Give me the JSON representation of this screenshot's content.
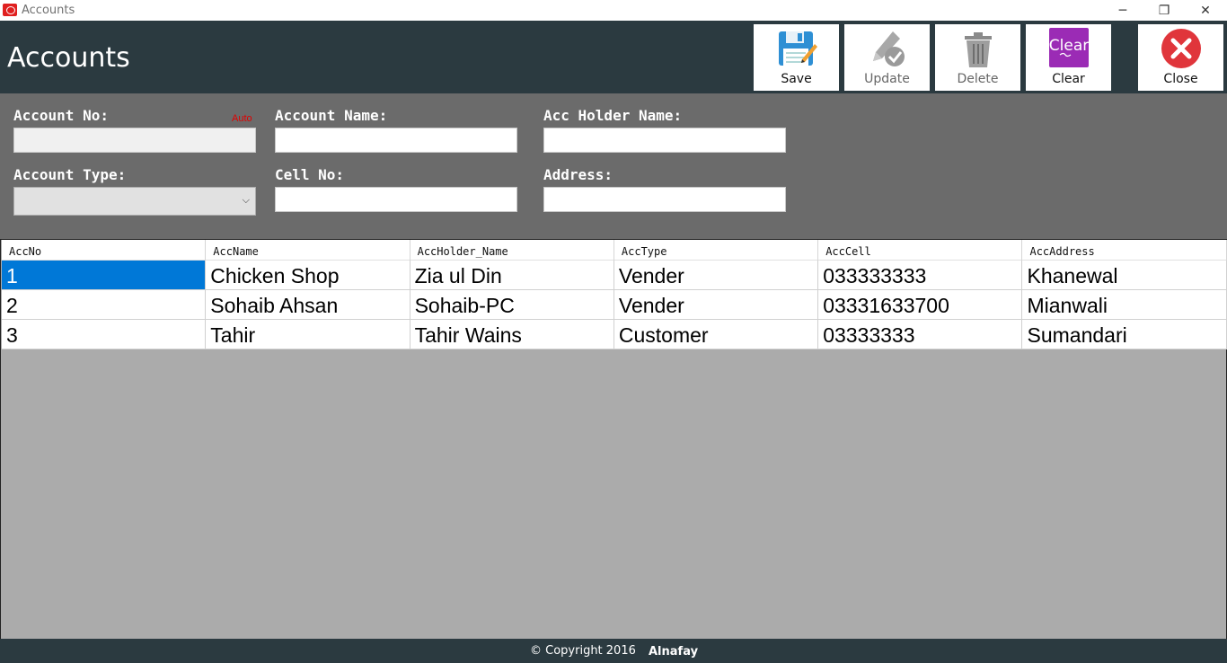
{
  "window": {
    "title": "Accounts",
    "controls": {
      "minimize": "─",
      "maximize": "❐",
      "close": "✕"
    }
  },
  "header": {
    "title": "Accounts"
  },
  "toolbar": {
    "save_label": "Save",
    "update_label": "Update",
    "delete_label": "Delete",
    "clear_label": "Clear",
    "clear_icon_text": "Clear",
    "close_label": "Close"
  },
  "form": {
    "account_no_label": "Account No:",
    "auto_tag": "Auto",
    "account_name_label": "Account Name:",
    "acc_holder_name_label": "Acc Holder Name:",
    "account_type_label": "Account Type:",
    "cell_no_label": "Cell No:",
    "address_label": "Address:",
    "account_no_value": "",
    "account_name_value": "",
    "acc_holder_name_value": "",
    "account_type_value": "",
    "cell_no_value": "",
    "address_value": ""
  },
  "grid": {
    "columns": [
      "AccNo",
      "AccName",
      "AccHolder_Name",
      "AccType",
      "AccCell",
      "AccAddress"
    ],
    "rows": [
      [
        "1",
        "Chicken Shop",
        "Zia ul Din",
        "Vender",
        "033333333",
        "Khanewal"
      ],
      [
        "2",
        "Sohaib Ahsan",
        "Sohaib-PC",
        "Vender",
        "03331633700",
        "Mianwali"
      ],
      [
        "3",
        "Tahir",
        "Tahir Wains",
        "Customer",
        "03333333",
        "Sumandari"
      ]
    ]
  },
  "footer": {
    "copyright": "© Copyright 2016",
    "brand": "Alnafay"
  },
  "colors": {
    "header_bg": "#2b3a40",
    "form_bg": "#6b6b6b",
    "grid_bg": "#ababab",
    "selection": "#0078d7",
    "clear_icon": "#9b2bb5",
    "close_icon": "#e0353b",
    "save_icon": "#2e8fd4"
  }
}
